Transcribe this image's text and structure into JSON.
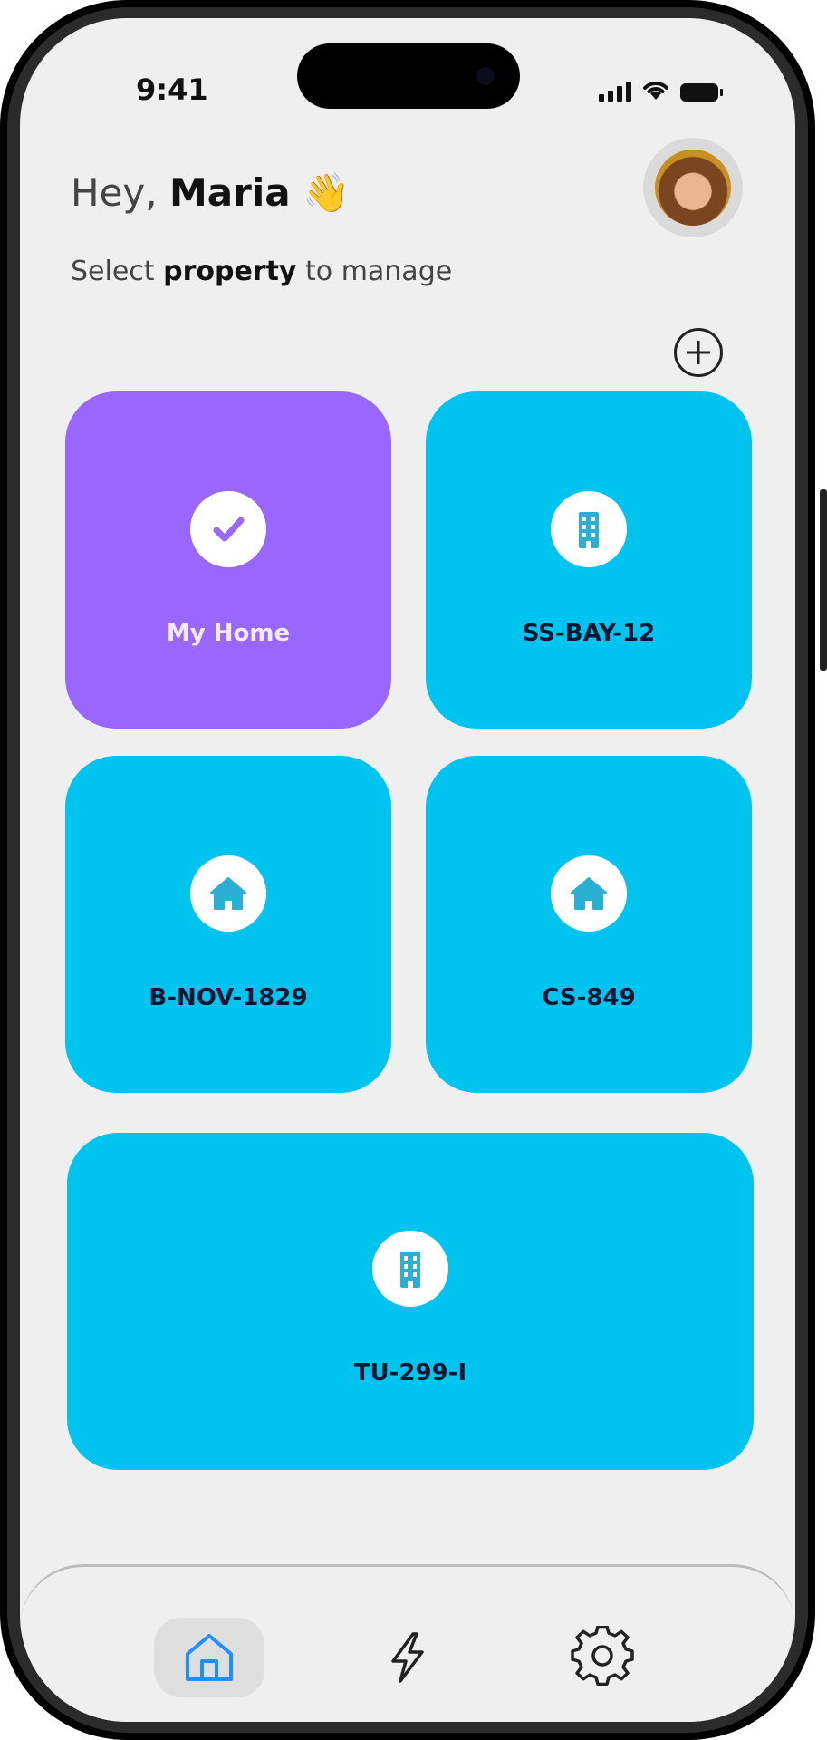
{
  "status_bar": {
    "time": "9:41"
  },
  "header": {
    "greeting_prefix": "Hey, ",
    "user_name": "Maria",
    "wave_emoji": "👋",
    "subtitle_prefix": "Select ",
    "subtitle_bold": "property",
    "subtitle_suffix": " to manage"
  },
  "properties": [
    {
      "label": "My Home",
      "icon": "check-icon",
      "selected": true
    },
    {
      "label": "SS-BAY-12",
      "icon": "building-icon",
      "selected": false
    },
    {
      "label": "B-NOV-1829",
      "icon": "house-icon",
      "selected": false
    },
    {
      "label": "CS-849",
      "icon": "house-icon",
      "selected": false
    },
    {
      "label": "TU-299-I",
      "icon": "building-icon",
      "selected": false
    }
  ],
  "bottom_nav": [
    {
      "icon": "home-icon",
      "active": true
    },
    {
      "icon": "lightning-icon",
      "active": false
    },
    {
      "icon": "gear-icon",
      "active": false
    }
  ],
  "colors": {
    "selected_card": "#9966ff",
    "card": "#00c4f0",
    "active_nav_icon": "#1e90ff",
    "background": "#efefef"
  }
}
